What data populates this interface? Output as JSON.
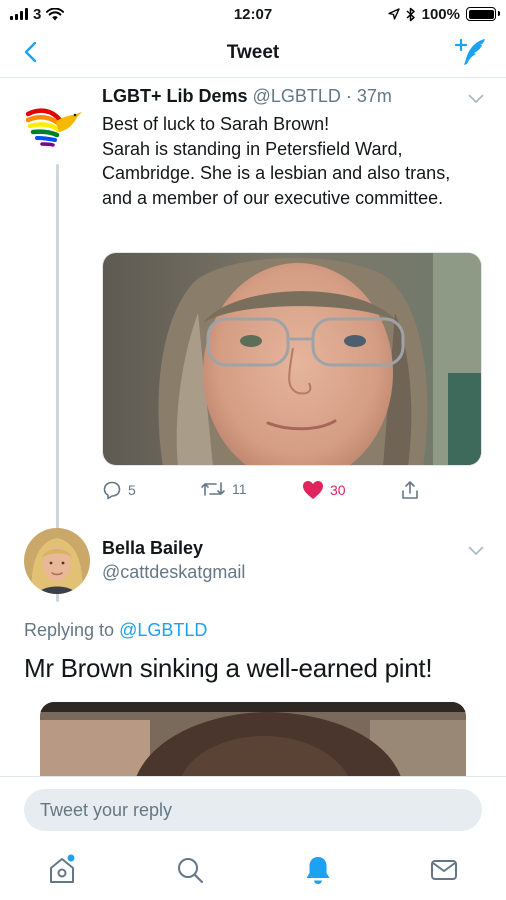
{
  "status_bar": {
    "carrier": "3",
    "time": "12:07",
    "battery": "100%",
    "battery_level": 1.0
  },
  "nav": {
    "title": "Tweet",
    "back_icon": "chevron-left-icon",
    "compose_icon": "compose-tweet-icon"
  },
  "tweet": {
    "name": "LGBT+ Lib Dems",
    "handle": "@LGBTLD",
    "time": "· 37m",
    "lines": [
      "Best of luck to Sarah Brown!",
      "Sarah is standing in Petersfield Ward, Cambridge. She is a lesbian and also trans, and a member of our executive committee."
    ],
    "actions": {
      "replies": "5",
      "retweets": "11",
      "likes": "30"
    }
  },
  "reply_tweet": {
    "name": "Bella Bailey",
    "handle": "@cattdeskatgmail",
    "replying_prefix": "Replying to",
    "replying_to": "@LGBTLD",
    "text": "Mr Brown sinking a well-earned pint!"
  },
  "composer": {
    "placeholder": "Tweet your reply"
  },
  "tab_bar": [
    "home-icon",
    "search-icon",
    "notifications-icon",
    "messages-icon"
  ],
  "colors": {
    "accent": "#1da1f2",
    "like": "#e0245e",
    "muted": "#657786"
  }
}
